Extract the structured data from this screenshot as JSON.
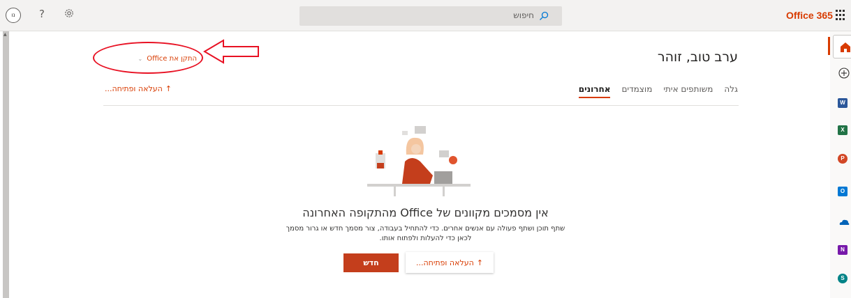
{
  "topbar": {
    "avatar_initials": "נו",
    "help_label": "?",
    "search_placeholder": "חיפוש",
    "brand": "Office 365"
  },
  "header": {
    "greeting": "ערב טוב, זוהר",
    "install_label": "התקן את Office",
    "install_chevron": "⌄"
  },
  "tabs": [
    {
      "label": "אחרונים",
      "active": true
    },
    {
      "label": "מוצמדים",
      "active": false
    },
    {
      "label": "משותפים איתי",
      "active": false
    },
    {
      "label": "גלה",
      "active": false
    }
  ],
  "upload_link": "העלאה ופתיחה...",
  "upload_icon": "↑",
  "empty_state": {
    "title": "אין מסמכים מקוונים של Office מהתקופה האחרונה",
    "desc_line1": "שתף תוכן ושתף פעולה עם אנשים אחרים. כדי להתחיל בעבודה, צור מסמך חדש או גרור מסמך",
    "desc_line2": "לכאן כדי להעלות ולפתוח אותו.",
    "upload_button": "העלאה ופתיחה...",
    "new_button": "חדש"
  },
  "rail": [
    {
      "name": "home",
      "letter": ""
    },
    {
      "name": "add",
      "letter": "+"
    },
    {
      "name": "word",
      "letter": "W",
      "color": "#2b579a"
    },
    {
      "name": "excel",
      "letter": "X",
      "color": "#217346"
    },
    {
      "name": "powerpoint",
      "letter": "P",
      "color": "#d24726"
    },
    {
      "name": "outlook",
      "letter": "O",
      "color": "#0078d4"
    },
    {
      "name": "onedrive",
      "letter": "",
      "color": "#0364b8"
    },
    {
      "name": "onenote",
      "letter": "N",
      "color": "#7719aa"
    },
    {
      "name": "sharepoint",
      "letter": "S",
      "color": "#038387"
    }
  ],
  "colors": {
    "accent": "#d83b01",
    "new_button": "#c43e1c",
    "callout": "#e81123"
  }
}
